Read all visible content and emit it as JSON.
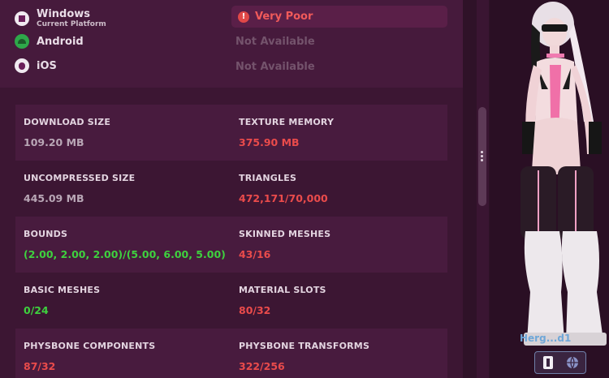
{
  "platforms": [
    {
      "name": "Windows",
      "sub": "Current Platform",
      "status": "Very Poor",
      "icon": "windows-icon"
    },
    {
      "name": "Android",
      "status": "Not Available",
      "icon": "android-icon"
    },
    {
      "name": "iOS",
      "status": "Not Available",
      "icon": "apple-icon"
    }
  ],
  "stats": [
    {
      "left": {
        "label": "DOWNLOAD SIZE",
        "value": "109.20 MB",
        "color": "#b9a7b6"
      },
      "right": {
        "label": "TEXTURE MEMORY",
        "value": "375.90 MB",
        "color": "#ea4b4b"
      }
    },
    {
      "left": {
        "label": "UNCOMPRESSED SIZE",
        "value": "445.09 MB",
        "color": "#b9a7b6"
      },
      "right": {
        "label": "TRIANGLES",
        "value": "472,171/70,000",
        "color": "#ea4b4b"
      }
    },
    {
      "left": {
        "label": "BOUNDS",
        "value": "(2.00, 2.00, 2.00)/(5.00, 6.00, 5.00)",
        "color": "#3ed13e"
      },
      "right": {
        "label": "SKINNED MESHES",
        "value": "43/16",
        "color": "#ea4b4b"
      }
    },
    {
      "left": {
        "label": "BASIC MESHES",
        "value": "0/24",
        "color": "#3ed13e"
      },
      "right": {
        "label": "MATERIAL SLOTS",
        "value": "80/32",
        "color": "#ea4b4b"
      }
    },
    {
      "left": {
        "label": "PHYSBONE COMPONENTS",
        "value": "87/32",
        "color": "#ea4b4b"
      },
      "right": {
        "label": "PHYSBONE TRANSFORMS",
        "value": "322/256",
        "color": "#ea4b4b"
      }
    }
  ],
  "preview": {
    "avatar_name": "Herg...d1",
    "buttons": [
      "fullbody-view-icon",
      "globe-view-icon"
    ]
  },
  "colors": {
    "bad": "#ea4b4b",
    "good": "#3ed13e",
    "neutral": "#b9a7b6",
    "accent": "#5a1f48"
  }
}
